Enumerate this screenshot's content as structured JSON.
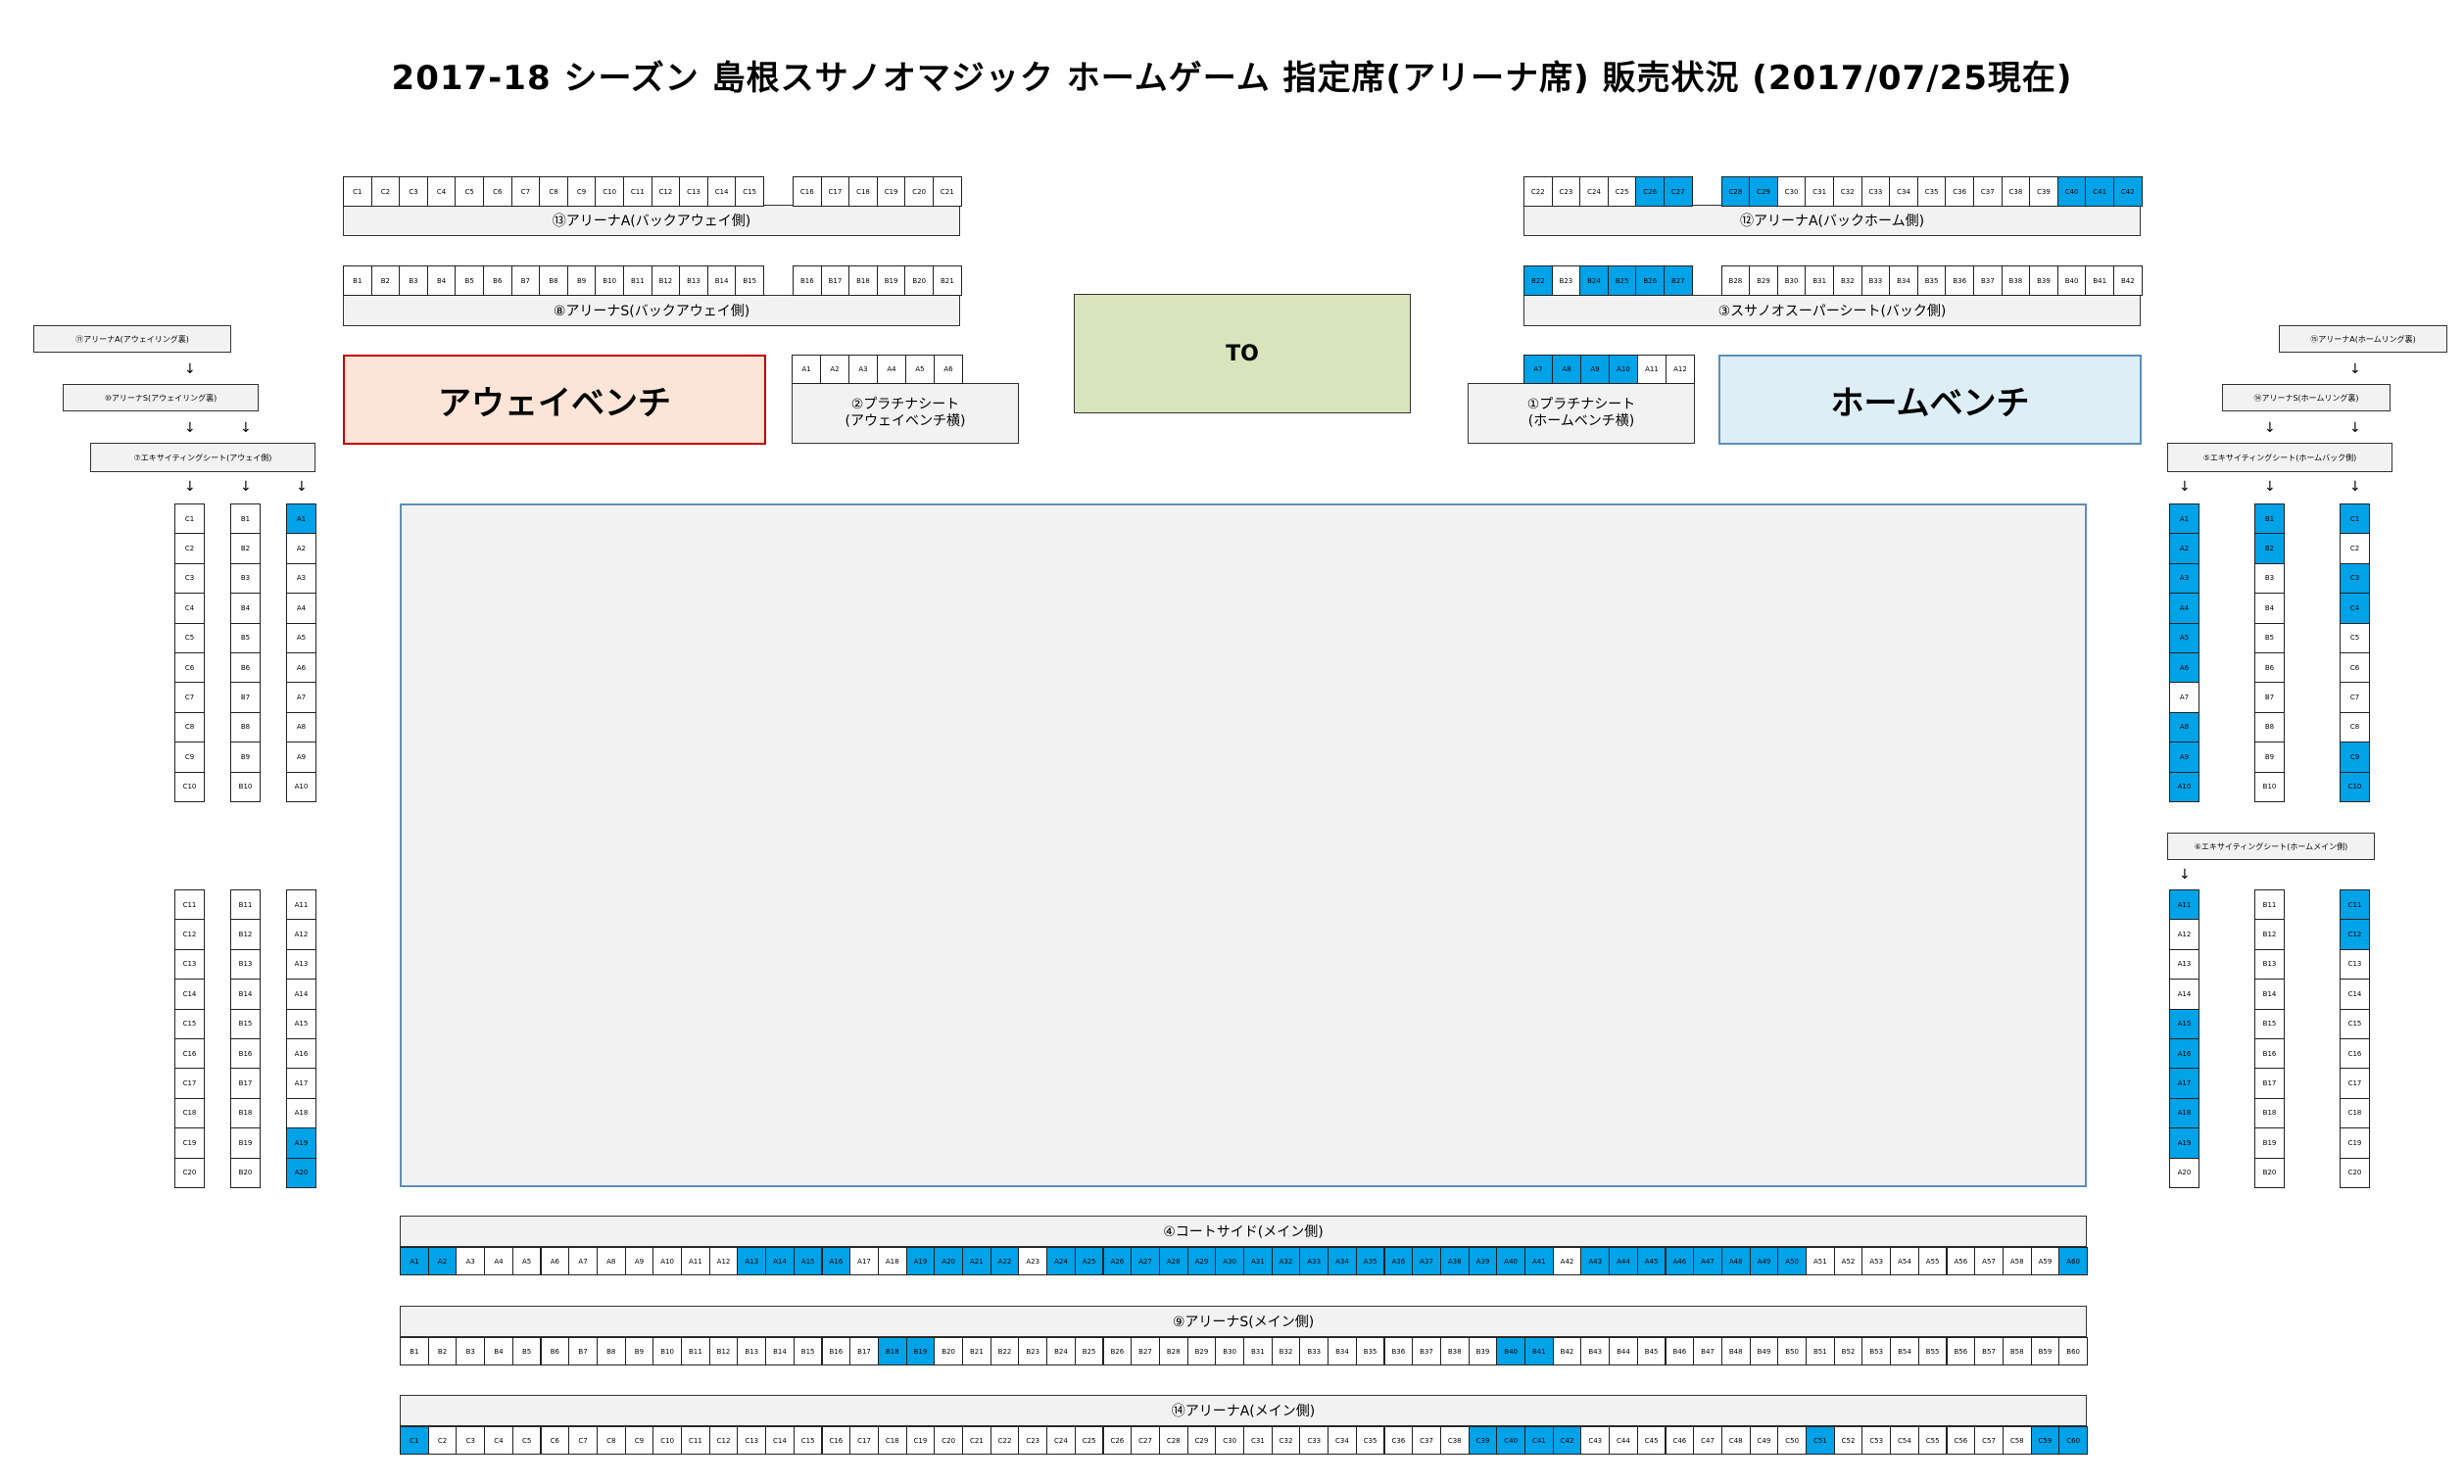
{
  "title": "2017-18 シーズン 島根スサノオマジック ホームゲーム 指定席(アリーナ席) 販売状況 (2017/07/25現在)",
  "colors": {
    "sold": "#00a2e8",
    "vacant": "#ffffff",
    "away_bench_bg": "#fce4d6",
    "away_bench_border": "#c00000",
    "home_bench_bg": "#ddeef6",
    "home_bench_border": "#5b8fb9",
    "to_bg": "#d8e4bc"
  },
  "labels": {
    "away_bench": "アウェイベンチ",
    "home_bench": "ホームベンチ",
    "to": "TO",
    "s13": "⑬アリーナA(バックアウェイ側)",
    "s12": "⑫アリーナA(バックホーム側)",
    "s8": "⑧アリーナS(バックアウェイ側)",
    "s3": "③スサノオスーパーシート(バック側)",
    "s2": "②プラチナシート\n(アウェイベンチ横)",
    "s1": "①プラチナシート\n(ホームベンチ横)",
    "s11": "⑪アリーナA(アウェイリング裏)",
    "s10": "⑩アリーナS(アウェイリング裏)",
    "s7": "⑦エキサイティングシート(アウェイ側)",
    "s15": "⑮アリーナA(ホームリング裏)",
    "s14r": "⑭アリーナS(ホームリング裏)",
    "s5": "⑤エキサイティングシート(ホームバック側)",
    "s6": "⑥エキサイティングシート(ホームメイン側)",
    "s4": "④コートサイド(メイン側)",
    "s9": "⑨アリーナS(メイン側)",
    "s14": "⑭アリーナA(メイン側)"
  },
  "rows": {
    "r13": {
      "seats": [
        "C1",
        "C2",
        "C3",
        "C4",
        "C5",
        "C6",
        "C7",
        "C8",
        "C9",
        "C10",
        "C11",
        "C12",
        "C13",
        "C14",
        "C15",
        "C16",
        "C17",
        "C18",
        "C19",
        "C20",
        "C21"
      ],
      "sold": []
    },
    "r12": {
      "seats": [
        "C22",
        "C23",
        "C24",
        "C25",
        "C26",
        "C27",
        "C28",
        "C29",
        "C30",
        "C31",
        "C32",
        "C33",
        "C34",
        "C35",
        "C36",
        "C37",
        "C38",
        "C39",
        "C40",
        "C41",
        "C42"
      ],
      "sold": [
        "C26",
        "C27",
        "C28",
        "C29",
        "C40",
        "C41",
        "C42"
      ]
    },
    "r8": {
      "seats": [
        "B1",
        "B2",
        "B3",
        "B4",
        "B5",
        "B6",
        "B7",
        "B8",
        "B9",
        "B10",
        "B11",
        "B12",
        "B13",
        "B14",
        "B15",
        "B16",
        "B17",
        "B18",
        "B19",
        "B20",
        "B21"
      ],
      "sold": []
    },
    "r3": {
      "seats": [
        "B22",
        "B23",
        "B24",
        "B25",
        "B26",
        "B27",
        "B28",
        "B29",
        "B30",
        "B31",
        "B32",
        "B33",
        "B34",
        "B35",
        "B36",
        "B37",
        "B38",
        "B39",
        "B40",
        "B41",
        "B42"
      ],
      "sold": [
        "B22",
        "B24",
        "B25",
        "B26",
        "B27"
      ]
    },
    "r2": {
      "seats": [
        "A1",
        "A2",
        "A3",
        "A4",
        "A5",
        "A6"
      ],
      "sold": []
    },
    "r1": {
      "seats": [
        "A7",
        "A8",
        "A9",
        "A10",
        "A11",
        "A12"
      ],
      "sold": [
        "A7",
        "A8",
        "A9",
        "A10"
      ]
    },
    "lc1": {
      "seats": [
        "C1",
        "C2",
        "C3",
        "C4",
        "C5",
        "C6",
        "C7",
        "C8",
        "C9",
        "C10"
      ],
      "sold": []
    },
    "lb1": {
      "seats": [
        "B1",
        "B2",
        "B3",
        "B4",
        "B5",
        "B6",
        "B7",
        "B8",
        "B9",
        "B10"
      ],
      "sold": []
    },
    "la1": {
      "seats": [
        "A1",
        "A2",
        "A3",
        "A4",
        "A5",
        "A6",
        "A7",
        "A8",
        "A9",
        "A10"
      ],
      "sold": [
        "A1"
      ]
    },
    "lc2": {
      "seats": [
        "C11",
        "C12",
        "C13",
        "C14",
        "C15",
        "C16",
        "C17",
        "C18",
        "C19",
        "C20"
      ],
      "sold": []
    },
    "lb2": {
      "seats": [
        "B11",
        "B12",
        "B13",
        "B14",
        "B15",
        "B16",
        "B17",
        "B18",
        "B19",
        "B20"
      ],
      "sold": []
    },
    "la2": {
      "seats": [
        "A11",
        "A12",
        "A13",
        "A14",
        "A15",
        "A16",
        "A17",
        "A18",
        "A19",
        "A20"
      ],
      "sold": [
        "A19",
        "A20"
      ]
    },
    "ra1": {
      "seats": [
        "A1",
        "A2",
        "A3",
        "A4",
        "A5",
        "A6",
        "A7",
        "A8",
        "A9",
        "A10"
      ],
      "sold": [
        "A1",
        "A2",
        "A3",
        "A4",
        "A5",
        "A6",
        "A8",
        "A9",
        "A10"
      ]
    },
    "rb1": {
      "seats": [
        "B1",
        "B2",
        "B3",
        "B4",
        "B5",
        "B6",
        "B7",
        "B8",
        "B9",
        "B10"
      ],
      "sold": [
        "B1",
        "B2"
      ]
    },
    "rc1": {
      "seats": [
        "C1",
        "C2",
        "C3",
        "C4",
        "C5",
        "C6",
        "C7",
        "C8",
        "C9",
        "C10"
      ],
      "sold": [
        "C1",
        "C3",
        "C4",
        "C9",
        "C10"
      ]
    },
    "ra2": {
      "seats": [
        "A11",
        "A12",
        "A13",
        "A14",
        "A15",
        "A16",
        "A17",
        "A18",
        "A19",
        "A20"
      ],
      "sold": [
        "A11",
        "A15",
        "A16",
        "A17",
        "A18",
        "A19"
      ]
    },
    "rb2": {
      "seats": [
        "B11",
        "B12",
        "B13",
        "B14",
        "B15",
        "B16",
        "B17",
        "B18",
        "B19",
        "B20"
      ],
      "sold": []
    },
    "rc2": {
      "seats": [
        "C11",
        "C12",
        "C13",
        "C14",
        "C15",
        "C16",
        "C17",
        "C18",
        "C19",
        "C20"
      ],
      "sold": [
        "C11",
        "C12"
      ]
    },
    "r4": {
      "seats": [
        "A1",
        "A2",
        "A3",
        "A4",
        "A5",
        "A6",
        "A7",
        "A8",
        "A9",
        "A10",
        "A11",
        "A12",
        "A13",
        "A14",
        "A15",
        "A16",
        "A17",
        "A18",
        "A19",
        "A20",
        "A21",
        "A22",
        "A23",
        "A24",
        "A25",
        "A26",
        "A27",
        "A28",
        "A29",
        "A30",
        "A31",
        "A32",
        "A33",
        "A34",
        "A35",
        "A36",
        "A37",
        "A38",
        "A39",
        "A40",
        "A41",
        "A42",
        "A43",
        "A44",
        "A45",
        "A46",
        "A47",
        "A48",
        "A49",
        "A50",
        "A51",
        "A52",
        "A53",
        "A54",
        "A55",
        "A56",
        "A57",
        "A58",
        "A59",
        "A60"
      ],
      "sold": [
        "A1",
        "A2",
        "A13",
        "A14",
        "A15",
        "A16",
        "A19",
        "A20",
        "A21",
        "A22",
        "A24",
        "A25",
        "A26",
        "A27",
        "A28",
        "A29",
        "A30",
        "A31",
        "A32",
        "A33",
        "A34",
        "A35",
        "A36",
        "A37",
        "A38",
        "A39",
        "A40",
        "A41",
        "A43",
        "A44",
        "A45",
        "A46",
        "A47",
        "A48",
        "A49",
        "A50",
        "A60"
      ]
    },
    "r9": {
      "seats": [
        "B1",
        "B2",
        "B3",
        "B4",
        "B5",
        "B6",
        "B7",
        "B8",
        "B9",
        "B10",
        "B11",
        "B12",
        "B13",
        "B14",
        "B15",
        "B16",
        "B17",
        "B18",
        "B19",
        "B20",
        "B21",
        "B22",
        "B23",
        "B24",
        "B25",
        "B26",
        "B27",
        "B28",
        "B29",
        "B30",
        "B31",
        "B32",
        "B33",
        "B34",
        "B35",
        "B36",
        "B37",
        "B38",
        "B39",
        "B40",
        "B41",
        "B42",
        "B43",
        "B44",
        "B45",
        "B46",
        "B47",
        "B48",
        "B49",
        "B50",
        "B51",
        "B52",
        "B53",
        "B54",
        "B55",
        "B56",
        "B57",
        "B58",
        "B59",
        "B60"
      ],
      "sold": [
        "B18",
        "B19",
        "B40",
        "B41"
      ]
    },
    "r14": {
      "seats": [
        "C1",
        "C2",
        "C3",
        "C4",
        "C5",
        "C6",
        "C7",
        "C8",
        "C9",
        "C10",
        "C11",
        "C12",
        "C13",
        "C14",
        "C15",
        "C16",
        "C17",
        "C18",
        "C19",
        "C20",
        "C21",
        "C22",
        "C23",
        "C24",
        "C25",
        "C26",
        "C27",
        "C28",
        "C29",
        "C30",
        "C31",
        "C32",
        "C33",
        "C34",
        "C35",
        "C36",
        "C37",
        "C38",
        "C39",
        "C40",
        "C41",
        "C42",
        "C43",
        "C44",
        "C45",
        "C46",
        "C47",
        "C48",
        "C49",
        "C50",
        "C51",
        "C52",
        "C53",
        "C54",
        "C55",
        "C56",
        "C57",
        "C58",
        "C59",
        "C60"
      ],
      "sold": [
        "C1",
        "C39",
        "C40",
        "C41",
        "C42",
        "C51",
        "C59",
        "C60"
      ]
    }
  }
}
